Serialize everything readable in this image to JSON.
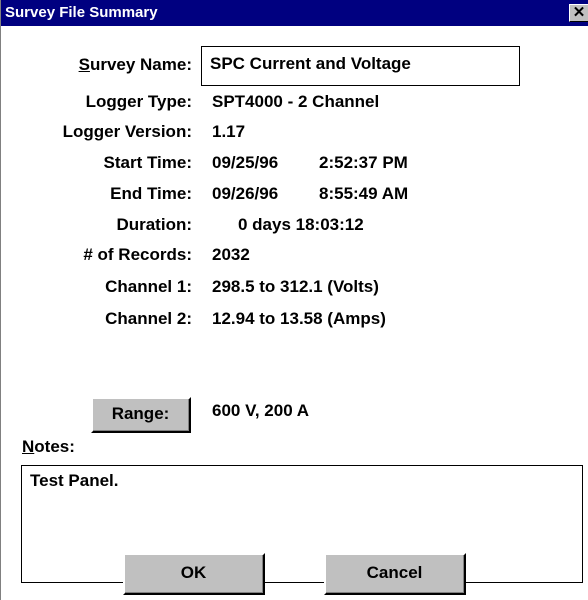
{
  "window": {
    "title": "Survey File Summary",
    "close_glyph": "✕"
  },
  "fields": {
    "survey_name": {
      "label_mnemonic": "S",
      "label_rest": "urvey Name:",
      "value": "SPC Current and Voltage"
    },
    "logger_type": {
      "label": "Logger Type:",
      "value": "SPT4000 - 2 Channel"
    },
    "logger_version": {
      "label": "Logger Version:",
      "value": "1.17"
    },
    "start_time": {
      "label": "Start Time:",
      "date": "09/25/96",
      "time": "2:52:37 PM"
    },
    "end_time": {
      "label": "End Time:",
      "date": "09/26/96",
      "time": "8:55:49 AM"
    },
    "duration": {
      "label": "Duration:",
      "value": "0 days 18:03:12"
    },
    "records": {
      "label": "# of Records:",
      "value": "2032"
    },
    "channel1": {
      "label": "Channel 1:",
      "value": "298.5 to 312.1 (Volts)"
    },
    "channel2": {
      "label": "Channel 2:",
      "value": "12.94 to 13.58 (Amps)"
    }
  },
  "range": {
    "button_label": "Range:",
    "value": "600 V, 200 A"
  },
  "notes": {
    "label_mnemonic": "N",
    "label_rest": "otes:",
    "value": "Test Panel."
  },
  "buttons": {
    "ok_label": "OK",
    "cancel_label": "Cancel"
  },
  "colors": {
    "titlebar": "#000080",
    "button_face": "#c0c0c0",
    "background": "#ffffff"
  }
}
